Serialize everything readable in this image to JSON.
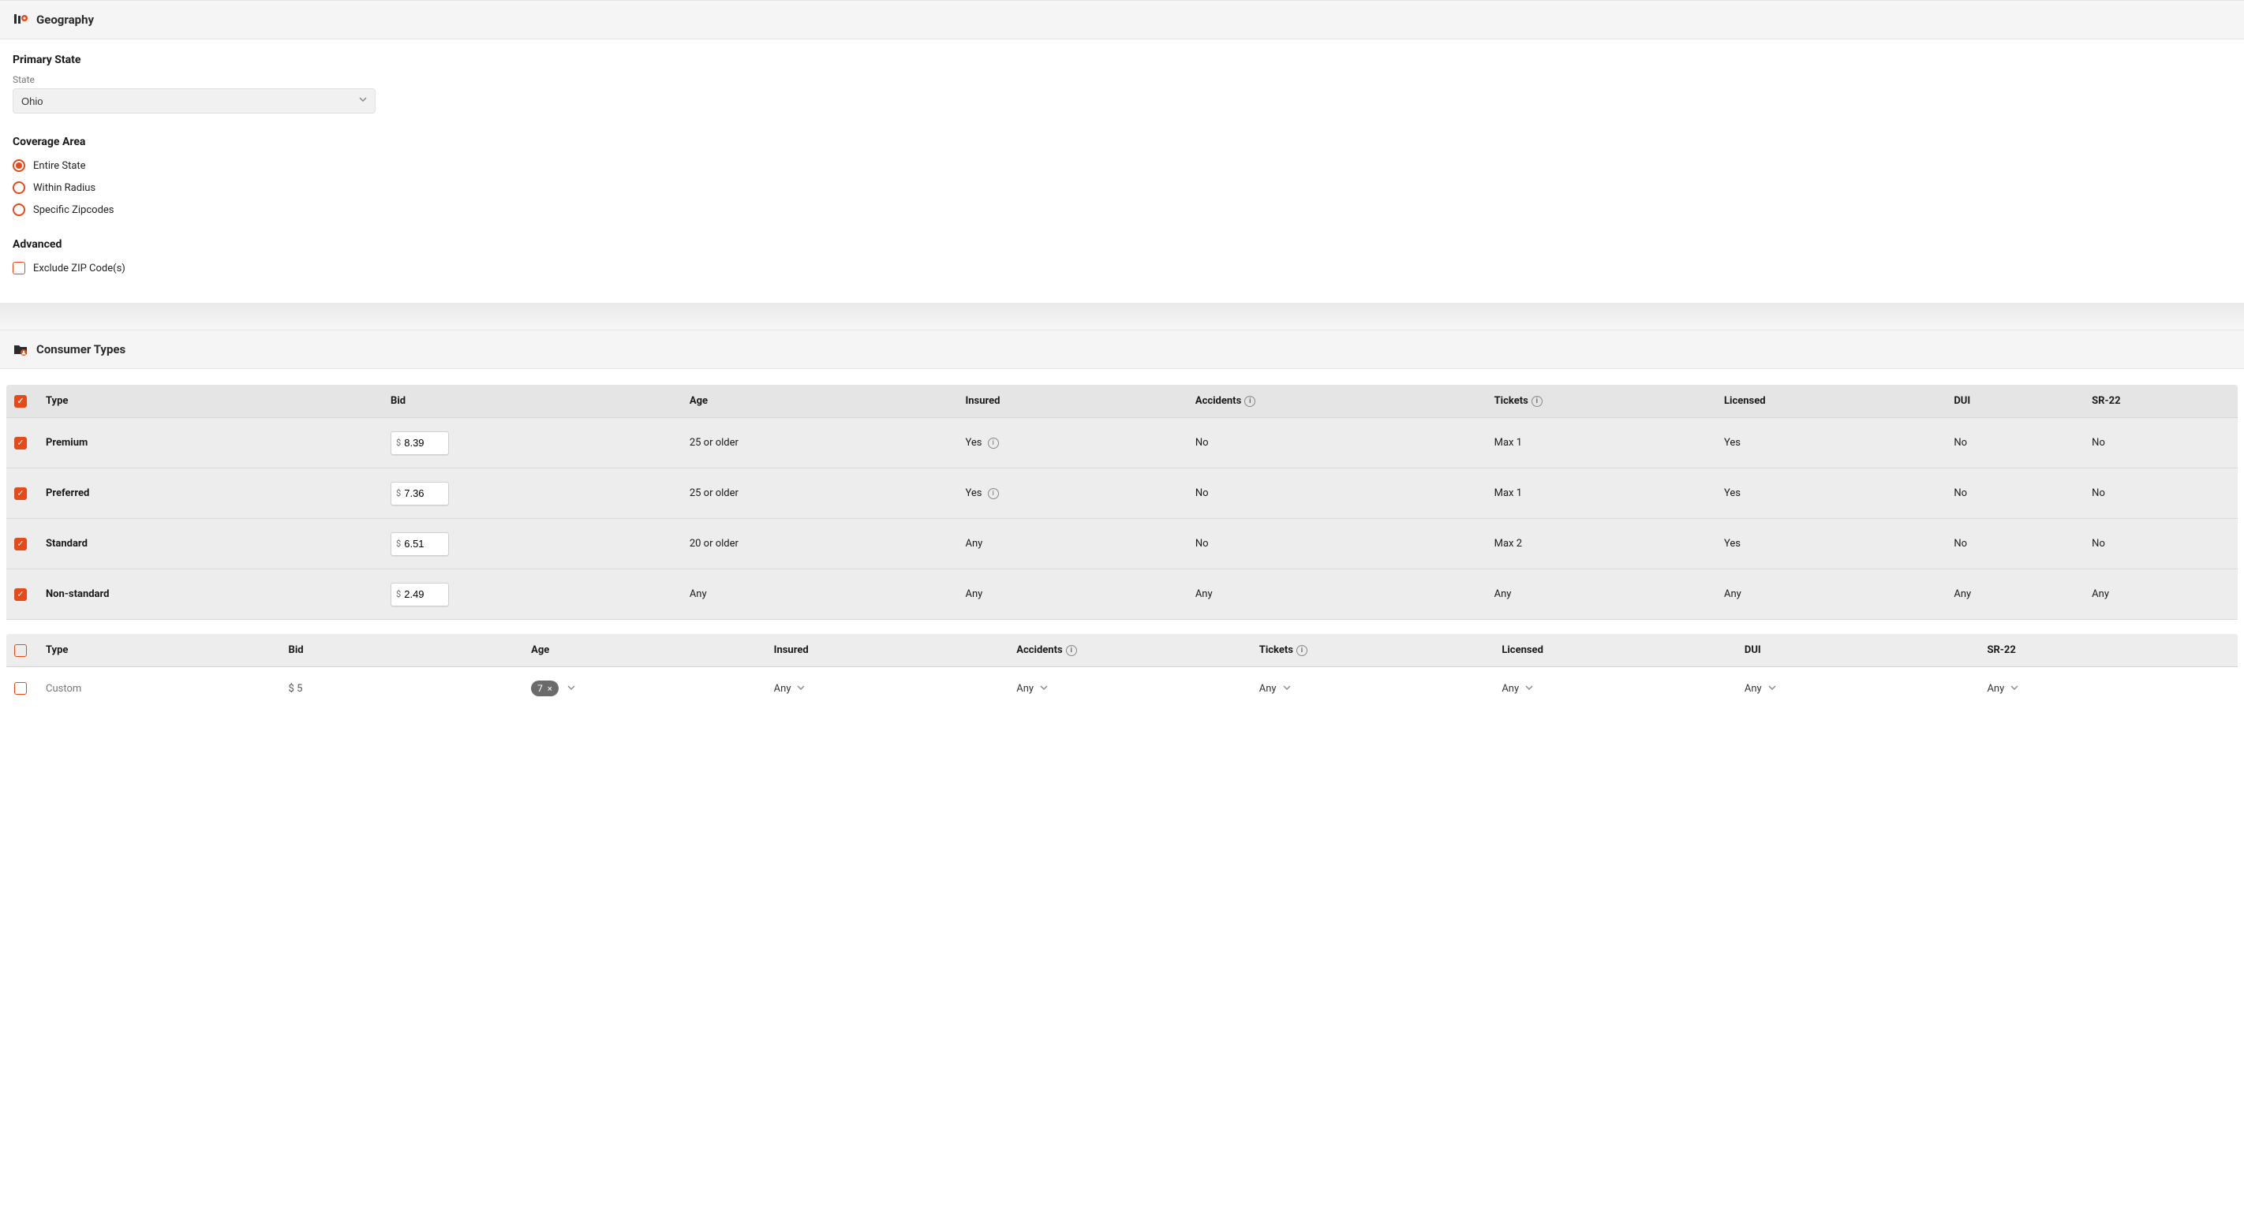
{
  "geography": {
    "title": "Geography",
    "primary_state": {
      "heading": "Primary State",
      "label": "State",
      "value": "Ohio"
    },
    "coverage_area": {
      "heading": "Coverage Area",
      "options": [
        {
          "label": "Entire State",
          "selected": true
        },
        {
          "label": "Within Radius",
          "selected": false
        },
        {
          "label": "Specific Zipcodes",
          "selected": false
        }
      ]
    },
    "advanced": {
      "heading": "Advanced",
      "exclude_zip": {
        "label": "Exclude ZIP Code(s)",
        "checked": false
      }
    }
  },
  "consumer_types": {
    "title": "Consumer Types",
    "headers": {
      "type": "Type",
      "bid": "Bid",
      "age": "Age",
      "insured": "Insured",
      "accidents": "Accidents",
      "tickets": "Tickets",
      "licensed": "Licensed",
      "dui": "DUI",
      "sr22": "SR-22"
    },
    "rows": [
      {
        "checked": true,
        "type": "Premium",
        "bid": "8.39",
        "age": "25 or older",
        "insured": "Yes",
        "insured_info": true,
        "accidents": "No",
        "tickets": "Max 1",
        "licensed": "Yes",
        "dui": "No",
        "sr22": "No"
      },
      {
        "checked": true,
        "type": "Preferred",
        "bid": "7.36",
        "age": "25 or older",
        "insured": "Yes",
        "insured_info": true,
        "accidents": "No",
        "tickets": "Max 1",
        "licensed": "Yes",
        "dui": "No",
        "sr22": "No"
      },
      {
        "checked": true,
        "type": "Standard",
        "bid": "6.51",
        "age": "20 or older",
        "insured": "Any",
        "insured_info": false,
        "accidents": "No",
        "tickets": "Max 2",
        "licensed": "Yes",
        "dui": "No",
        "sr22": "No"
      },
      {
        "checked": true,
        "type": "Non-standard",
        "bid": "2.49",
        "age": "Any",
        "insured": "Any",
        "insured_info": false,
        "accidents": "Any",
        "tickets": "Any",
        "licensed": "Any",
        "dui": "Any",
        "sr22": "Any"
      }
    ],
    "custom": {
      "checked": false,
      "type": "Custom",
      "bid_prefix": "$",
      "bid": "5",
      "age_pill": "7",
      "insured": "Any",
      "accidents": "Any",
      "tickets": "Any",
      "licensed": "Any",
      "dui": "Any",
      "sr22": "Any"
    }
  },
  "icons": {
    "info_letter": "i",
    "dollar": "$",
    "close_x": "×"
  }
}
